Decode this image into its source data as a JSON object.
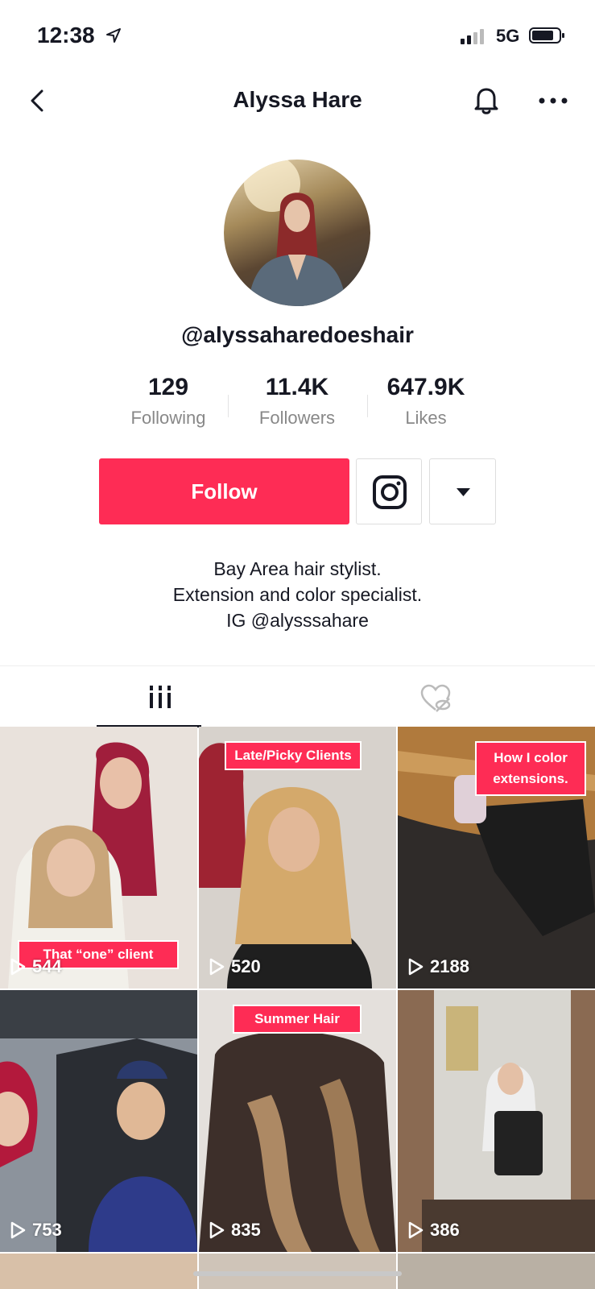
{
  "status": {
    "time": "12:38",
    "network": "5G"
  },
  "header": {
    "title": "Alyssa Hare"
  },
  "profile": {
    "handle": "@alyssaharedoeshair",
    "stats": [
      {
        "value": "129",
        "label": "Following"
      },
      {
        "value": "11.4K",
        "label": "Followers"
      },
      {
        "value": "647.9K",
        "label": "Likes"
      }
    ],
    "follow_label": "Follow",
    "bio": [
      "Bay Area hair stylist.",
      "Extension and color specialist.",
      "IG @alysssahare"
    ]
  },
  "accent": "#fe2c55",
  "videos": [
    {
      "views": "544",
      "caption": "That “one” client",
      "bg": "#d9b7a2"
    },
    {
      "views": "520",
      "caption": "Late/Picky Clients",
      "bg": "#b48a5b"
    },
    {
      "views": "2188",
      "caption": "How I color extensions.",
      "bg": "#5a4a38"
    },
    {
      "views": "753",
      "caption": "",
      "bg": "#6f7684"
    },
    {
      "views": "835",
      "caption": "Summer Hair",
      "bg": "#4a3a34"
    },
    {
      "views": "386",
      "caption": "",
      "bg": "#9b7e66"
    }
  ]
}
